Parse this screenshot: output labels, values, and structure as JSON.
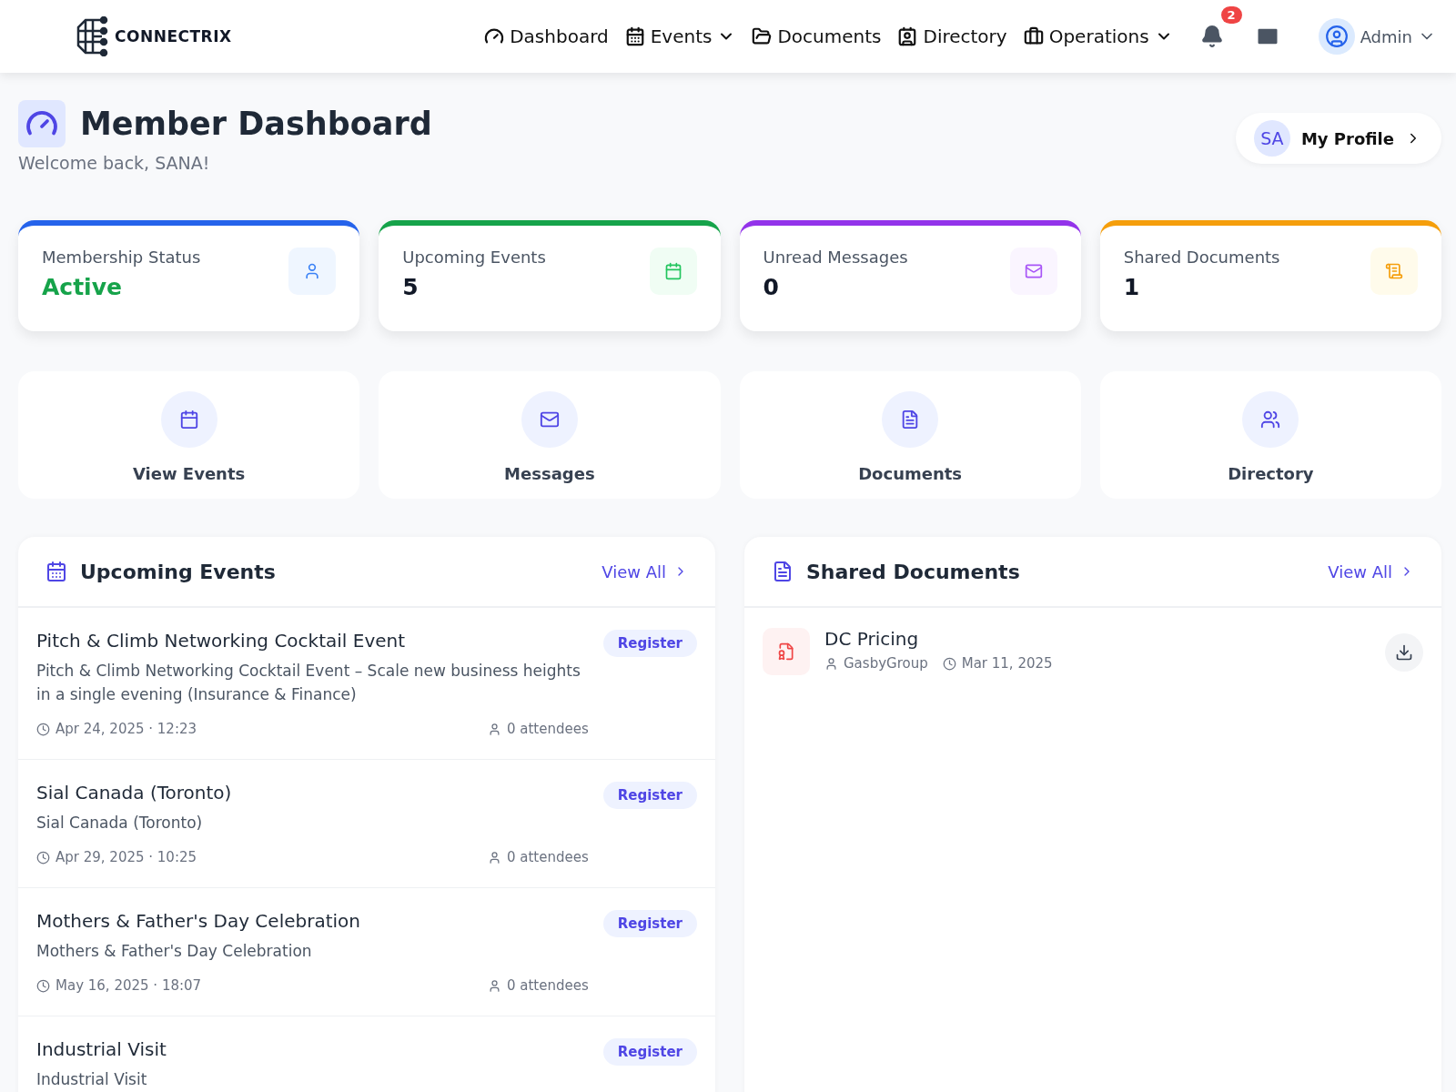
{
  "brand": {
    "name": "CONNECTRIX"
  },
  "nav": [
    {
      "label": "Dashboard",
      "dropdown": false
    },
    {
      "label": "Events",
      "dropdown": true
    },
    {
      "label": "Documents",
      "dropdown": false
    },
    {
      "label": "Directory",
      "dropdown": false
    },
    {
      "label": "Operations",
      "dropdown": true
    }
  ],
  "notifications": {
    "badge": "2"
  },
  "user": {
    "name": "Admin"
  },
  "page": {
    "title": "Member Dashboard",
    "subtitle": "Welcome back, SANA!",
    "profile": {
      "initials": "SA",
      "label": "My Profile"
    }
  },
  "stats": [
    {
      "label": "Membership Status",
      "value": "Active",
      "kind": "status",
      "color": "#2563eb"
    },
    {
      "label": "Upcoming Events",
      "value": "5",
      "kind": "count",
      "color": "#16a34a"
    },
    {
      "label": "Unread Messages",
      "value": "0",
      "kind": "count",
      "color": "#9333ea"
    },
    {
      "label": "Shared Documents",
      "value": "1",
      "kind": "count",
      "color": "#f59e0b"
    }
  ],
  "actions": [
    {
      "label": "View Events"
    },
    {
      "label": "Messages"
    },
    {
      "label": "Documents"
    },
    {
      "label": "Directory"
    }
  ],
  "events_panel": {
    "title": "Upcoming Events",
    "link": "View All",
    "events": [
      {
        "title": "Pitch & Climb Networking Cocktail Event",
        "description": "Pitch & Climb Networking Cocktail Event – Scale new business heights in a single evening (Insurance & Finance)",
        "date": "Apr 24, 2025 · 12:23",
        "attendees": "0 attendees",
        "action": "Register"
      },
      {
        "title": "Sial Canada (Toronto)",
        "description": "Sial Canada (Toronto)",
        "date": "Apr 29, 2025 · 10:25",
        "attendees": "0 attendees",
        "action": "Register"
      },
      {
        "title": "Mothers & Father's Day Celebration",
        "description": "Mothers & Father's Day Celebration",
        "date": "May 16, 2025 · 18:07",
        "attendees": "0 attendees",
        "action": "Register"
      },
      {
        "title": "Industrial Visit",
        "description": "Industrial Visit",
        "action": "Register"
      }
    ]
  },
  "documents_panel": {
    "title": "Shared Documents",
    "link": "View All",
    "documents": [
      {
        "name": "DC Pricing",
        "owner": "GasbyGroup",
        "date": "Mar 11, 2025"
      }
    ]
  }
}
